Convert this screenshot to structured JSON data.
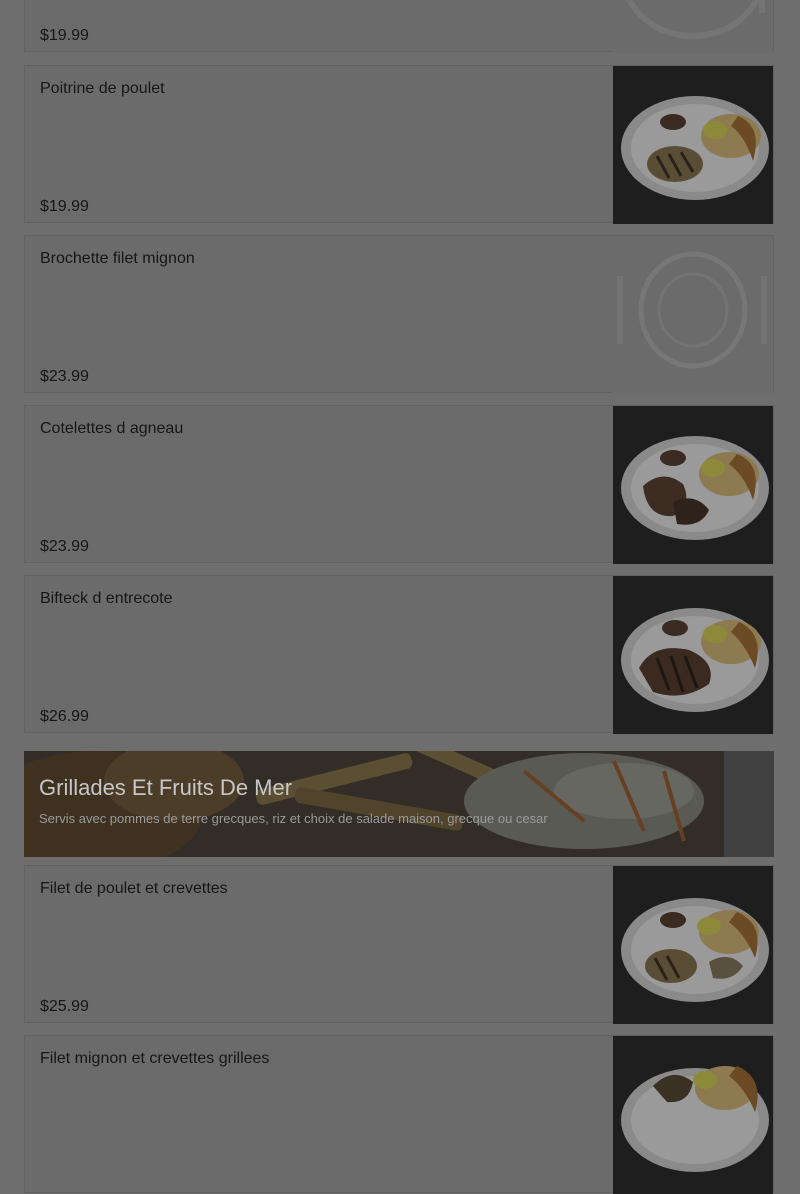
{
  "menu": {
    "items_top": [
      {
        "price": "$19.99"
      },
      {
        "name": "Poitrine de poulet",
        "price": "$19.99",
        "image": "chicken-breast-plate"
      },
      {
        "name": "Brochette filet mignon",
        "price": "$23.99",
        "image": "placeholder-plate-icon"
      },
      {
        "name": "Cotelettes d agneau",
        "price": "$23.99",
        "image": "lamb-chops-plate"
      },
      {
        "name": "Bifteck d entrecote",
        "price": "$26.99",
        "image": "ribeye-steak-plate"
      }
    ],
    "section": {
      "title": "Grillades Et Fruits De Mer",
      "subtitle": "Servis avec pommes de terre grecques, riz et choix de salade maison, grecque ou cesar"
    },
    "items_bottom": [
      {
        "name": "Filet de poulet et crevettes",
        "price": "$25.99",
        "image": "chicken-shrimp-plate"
      },
      {
        "name": "Filet mignon et crevettes grillees",
        "image": "filet-shrimp-plate"
      }
    ]
  }
}
